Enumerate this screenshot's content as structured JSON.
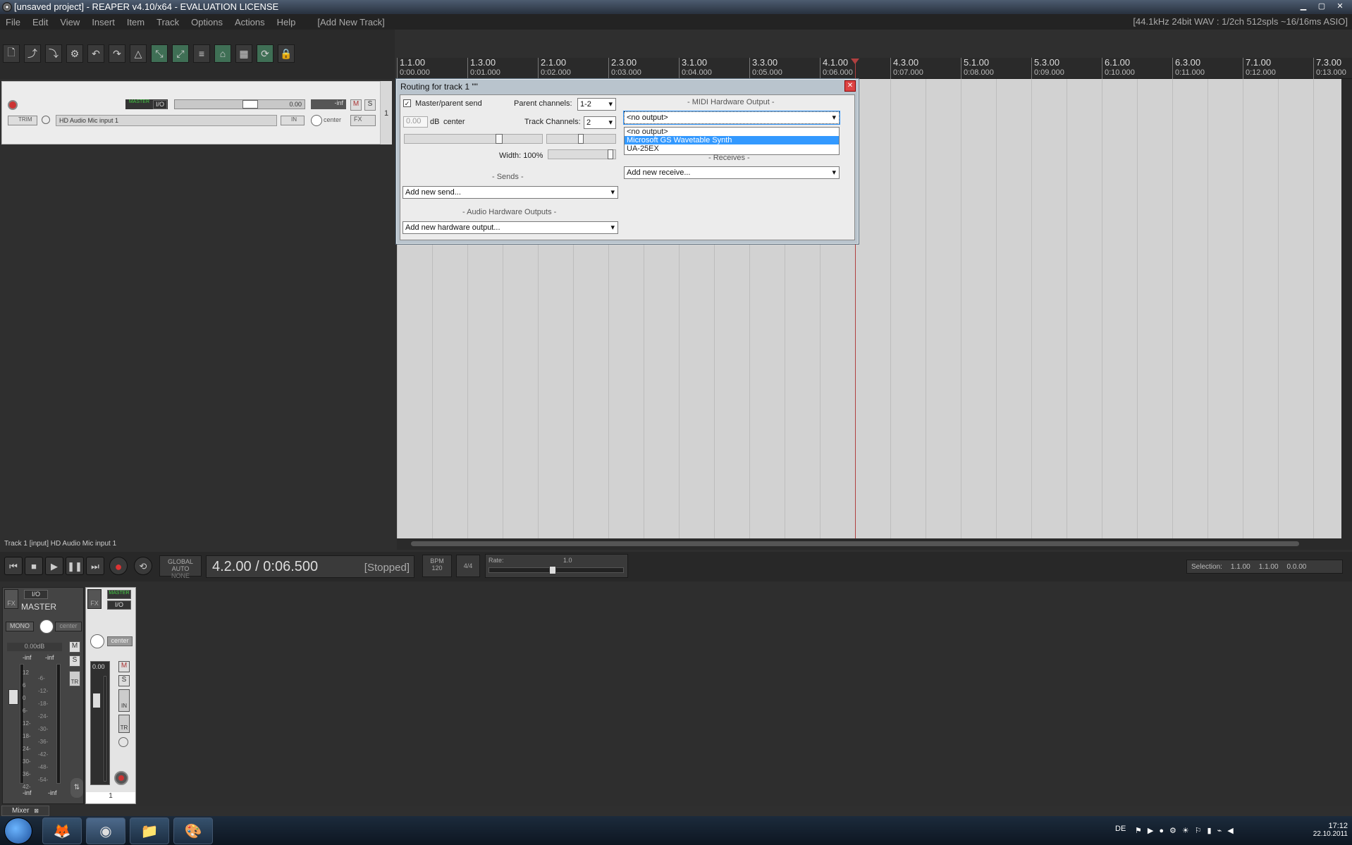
{
  "window": {
    "title": "[unsaved project] - REAPER v4.10/x64 - EVALUATION LICENSE",
    "min_icon": "minimize-icon",
    "max_icon": "maximize-icon",
    "close_icon": "close-icon"
  },
  "menu": {
    "items": [
      "File",
      "Edit",
      "View",
      "Insert",
      "Item",
      "Track",
      "Options",
      "Actions",
      "Help",
      "[Add New Track]"
    ],
    "audio_info": "[44.1kHz 24bit WAV : 1/2ch 512spls ~16/16ms ASIO]"
  },
  "timeline": {
    "marks": [
      {
        "bar": "1.1.00",
        "time": "0:00.000"
      },
      {
        "bar": "1.3.00",
        "time": "0:01.000"
      },
      {
        "bar": "2.1.00",
        "time": "0:02.000"
      },
      {
        "bar": "2.3.00",
        "time": "0:03.000"
      },
      {
        "bar": "3.1.00",
        "time": "0:04.000"
      },
      {
        "bar": "3.3.00",
        "time": "0:05.000"
      },
      {
        "bar": "4.1.00",
        "time": "0:06.000"
      },
      {
        "bar": "4.3.00",
        "time": "0:07.000"
      },
      {
        "bar": "5.1.00",
        "time": "0:08.000"
      },
      {
        "bar": "5.3.00",
        "time": "0:09.000"
      },
      {
        "bar": "6.1.00",
        "time": "0:10.000"
      },
      {
        "bar": "6.3.00",
        "time": "0:11.000"
      },
      {
        "bar": "7.1.00",
        "time": "0:12.000"
      },
      {
        "bar": "7.3.00",
        "time": "0:13.000"
      }
    ]
  },
  "track": {
    "number": "1",
    "io": "I/O",
    "volume": "0.00",
    "meter": "-inf",
    "mute": "M",
    "solo": "S",
    "trim": "TRIM",
    "input": "HD Audio Mic input 1",
    "in": "IN",
    "pan": "center",
    "fx": "FX",
    "master_label": "MASTER"
  },
  "routing": {
    "title": "Routing for track 1 \"\"",
    "master_send": "Master/parent send",
    "parent_channels_label": "Parent channels:",
    "parent_channels": "1-2",
    "volume": "0.00",
    "db": "dB",
    "pan": "center",
    "track_channels_label": "Track Channels:",
    "track_channels": "2",
    "width": "Width: 100%",
    "sends_head": "-  Sends  -",
    "add_send": "Add new send...",
    "hw_head": "-  Audio Hardware Outputs  -",
    "add_hw": "Add new hardware output...",
    "midi_head": "-  MIDI Hardware Output  -",
    "midi_selected": "<no output>",
    "midi_options": [
      "<no output>",
      "Microsoft GS Wavetable Synth",
      "UA-25EX"
    ],
    "receives_head": "-  Receives  -",
    "add_receive": "Add new receive..."
  },
  "status": {
    "track_info": "Track 1 [input] HD Audio Mic input 1"
  },
  "transport": {
    "global_auto": "GLOBAL AUTO",
    "none": "NONE",
    "position": "4.2.00 / 0:06.500",
    "state": "[Stopped]",
    "bpm_label": "BPM",
    "bpm": "120",
    "sig": "4/4",
    "rate_label": "Rate:",
    "rate": "1.0",
    "selection_label": "Selection:",
    "sel_start": "1.1.00",
    "sel_end": "1.1.00",
    "sel_len": "0.0.00"
  },
  "mixer": {
    "master": {
      "io": "I/O",
      "name": "MASTER",
      "mono": "MONO",
      "pan": "center",
      "db": "0.00dB",
      "peak_l": "-inf",
      "peak_r": "-inf",
      "scale": [
        "12",
        "6",
        "0",
        "6-",
        "12-",
        "18-",
        "24-",
        "30-",
        "36-",
        "42-"
      ],
      "scale_mid": [
        "-6-",
        "-12-",
        "-18-",
        "-24-",
        "-30-",
        "-36-",
        "-42-",
        "-48-",
        "-54-"
      ],
      "bottom_l": "-inf",
      "bottom_r": "-inf",
      "m": "M",
      "s": "S",
      "tr": "TR",
      "fx": "FX"
    },
    "track": {
      "io": "I/O",
      "pan": "center",
      "vol": "0.00",
      "m": "M",
      "s": "S",
      "in": "IN",
      "tr": "TR",
      "fx": "FX",
      "number": "1"
    },
    "tab": "Mixer"
  },
  "taskbar": {
    "lang": "DE",
    "time": "17:12",
    "date": "22.10.2011"
  },
  "colors": {
    "accent": "#3399ff",
    "playhead": "#b04040",
    "record": "#dd3333"
  }
}
